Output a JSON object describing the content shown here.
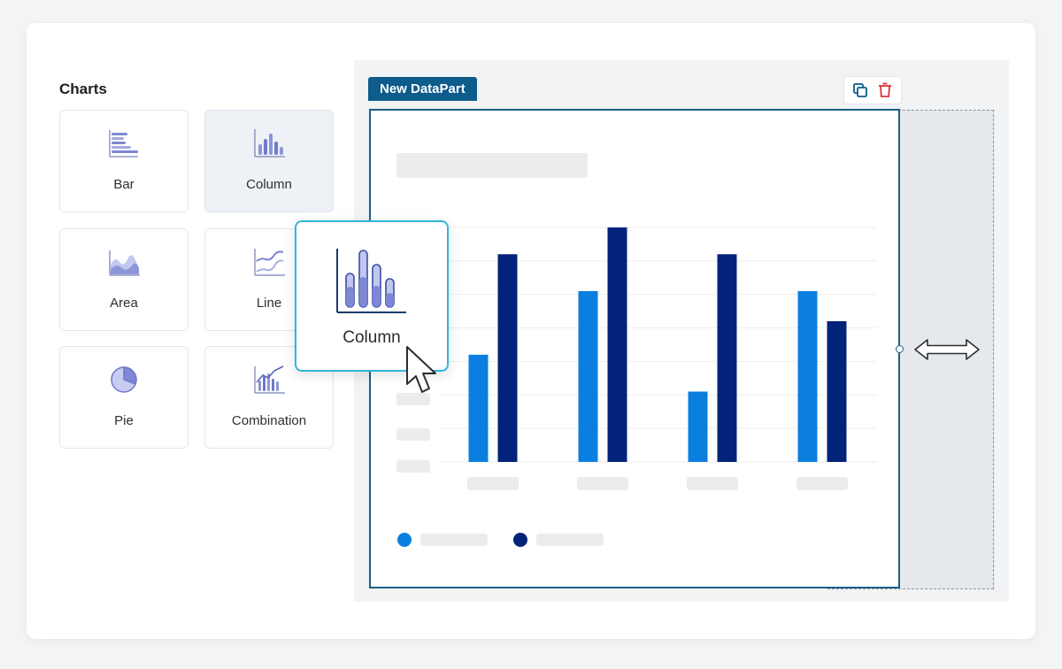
{
  "panel_title": "Charts",
  "chart_types": [
    {
      "label": "Bar",
      "icon": "bar-chart-icon"
    },
    {
      "label": "Column",
      "icon": "column-chart-icon",
      "selected": true
    },
    {
      "label": "Area",
      "icon": "area-chart-icon"
    },
    {
      "label": "Line",
      "icon": "line-chart-icon"
    },
    {
      "label": "Pie",
      "icon": "pie-chart-icon"
    },
    {
      "label": "Combination",
      "icon": "combination-chart-icon"
    }
  ],
  "drag_ghost": {
    "label": "Column",
    "icon": "column-chart-icon"
  },
  "datapart": {
    "label": "New DataPart",
    "toolbar": [
      {
        "icon": "duplicate-icon"
      },
      {
        "icon": "delete-icon"
      }
    ]
  },
  "colors": {
    "accent": "#0d5c8c",
    "series_light": "#0b7fe0",
    "series_dark": "#03237a",
    "ghost_border": "#34b4d8",
    "delete": "#d9343a"
  },
  "chart_data": {
    "type": "bar",
    "categories": [
      "",
      "",
      "",
      ""
    ],
    "series": [
      {
        "values": [
          32,
          51,
          21,
          51
        ]
      },
      {
        "values": [
          62,
          70,
          62,
          42
        ]
      }
    ],
    "ylim": [
      0,
      70
    ],
    "grid": true,
    "legend": "bottom-left"
  }
}
